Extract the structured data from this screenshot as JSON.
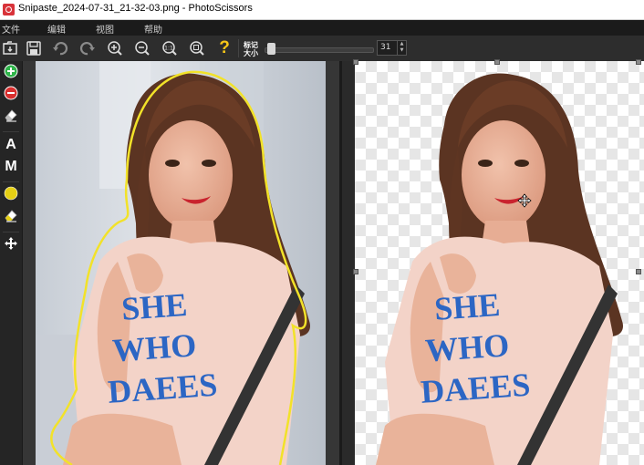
{
  "window": {
    "title": "Snipaste_2024-07-31_21-32-03.png - PhotoScissors"
  },
  "menu": {
    "items": [
      "文件",
      "编辑",
      "视图",
      "帮助"
    ]
  },
  "toolbar": {
    "icons": [
      "open-icon",
      "save-icon",
      "undo-icon",
      "redo-icon",
      "zoom-in-icon",
      "zoom-out-icon",
      "zoom-actual-icon",
      "zoom-fit-icon",
      "help-icon"
    ],
    "marker_size_label_line1": "标记",
    "marker_size_label_line2": "大小",
    "marker_size_value": "31",
    "help_glyph": "?"
  },
  "left_tools": {
    "foreground_marker": "plus-icon",
    "background_marker": "minus-icon",
    "eraser": "eraser-icon",
    "auto_label": "A",
    "manual_label": "M",
    "color_fill": "yellow-circle-icon",
    "bg_eraser": "eraser-icon",
    "move": "move-icon"
  },
  "shirt_text": {
    "line1": "SHE",
    "line2": "WHO",
    "line3": "DAEES"
  },
  "colors": {
    "accent_green": "#2fb44a",
    "accent_red": "#d9302f",
    "selection_outline": "#f2e229",
    "help_yellow": "#f5c518"
  }
}
